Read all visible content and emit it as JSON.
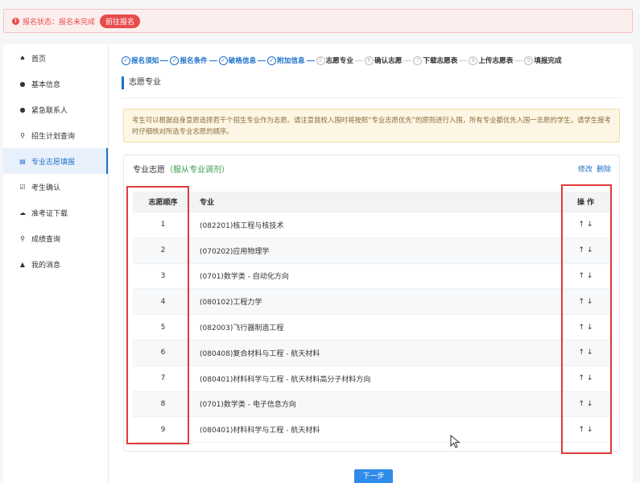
{
  "alert": {
    "status_text": "报名状态：报名未完成",
    "action_label": "前往报名",
    "icon": "alert-circle-icon"
  },
  "sidebar": {
    "items": [
      {
        "label": "首页",
        "icon": "home-icon",
        "glyph": "♠"
      },
      {
        "label": "基本信息",
        "icon": "user-icon",
        "glyph": "●"
      },
      {
        "label": "紧急联系人",
        "icon": "user-icon",
        "glyph": "●"
      },
      {
        "label": "招生计划查询",
        "icon": "search-icon",
        "glyph": "⚲"
      },
      {
        "label": "专业志愿填报",
        "icon": "doc-icon",
        "glyph": "▤"
      },
      {
        "label": "考生确认",
        "icon": "check-square-icon",
        "glyph": "☑"
      },
      {
        "label": "准考证下载",
        "icon": "cloud-download-icon",
        "glyph": "☁"
      },
      {
        "label": "成绩查询",
        "icon": "search-icon",
        "glyph": "⚲"
      },
      {
        "label": "我的消息",
        "icon": "bell-icon",
        "glyph": "🔔"
      }
    ]
  },
  "steps": [
    {
      "label": "报名须知",
      "num": "✓",
      "state": "done"
    },
    {
      "label": "报名条件",
      "num": "✓",
      "state": "done"
    },
    {
      "label": "破格信息",
      "num": "✓",
      "state": "done"
    },
    {
      "label": "附加信息",
      "num": "✓",
      "state": "done"
    },
    {
      "label": "志愿专业",
      "num": "5",
      "state": "todo"
    },
    {
      "label": "确认志愿",
      "num": "6",
      "state": "todo"
    },
    {
      "label": "下载志愿表",
      "num": "7",
      "state": "todo"
    },
    {
      "label": "上传志愿表",
      "num": "8",
      "state": "todo"
    },
    {
      "label": "填报完成",
      "num": "9",
      "state": "todo"
    }
  ],
  "section_title": "志愿专业",
  "notice": "考生可以根据自身意愿选择若干个招生专业作为志愿。请注意我校入围时将按照“专业志愿优先”的原则进行入围，所有专业都优先入围一志愿的学生，请学生报考时仔细核对所选专业志愿的顺序。",
  "card": {
    "title": "专业志愿",
    "sub": "（服从专业调剂）",
    "edit_label": "修改",
    "delete_label": "删除"
  },
  "table": {
    "headers": {
      "seq": "志愿顺序",
      "major": "专业",
      "op": "操作"
    },
    "rows": [
      {
        "seq": "1",
        "major": "(082201)核工程与核技术",
        "op": "↑↓"
      },
      {
        "seq": "2",
        "major": "(070202)应用物理学",
        "op": "↑↓"
      },
      {
        "seq": "3",
        "major": "(0701)数学类 - 自动化方向",
        "op": "↑↓"
      },
      {
        "seq": "4",
        "major": "(080102)工程力学",
        "op": "↑↓"
      },
      {
        "seq": "5",
        "major": "(082003)飞行器制造工程",
        "op": "↑↓"
      },
      {
        "seq": "6",
        "major": "(080408)复合材料与工程 - 航天材料",
        "op": "↑↓"
      },
      {
        "seq": "7",
        "major": "(080401)材料科学与工程 - 航天材料高分子材料方向",
        "op": "↑↓"
      },
      {
        "seq": "8",
        "major": "(0701)数学类 - 电子信息方向",
        "op": "↑↓"
      },
      {
        "seq": "9",
        "major": "(080401)材料科学与工程 - 航天材料",
        "op": "↑↓"
      }
    ]
  },
  "next_label": "下一步",
  "colors": {
    "accent": "#1d6fc9",
    "danger": "#e84c4c",
    "highlight": "#e03a3a",
    "success": "#3a9b4a"
  }
}
